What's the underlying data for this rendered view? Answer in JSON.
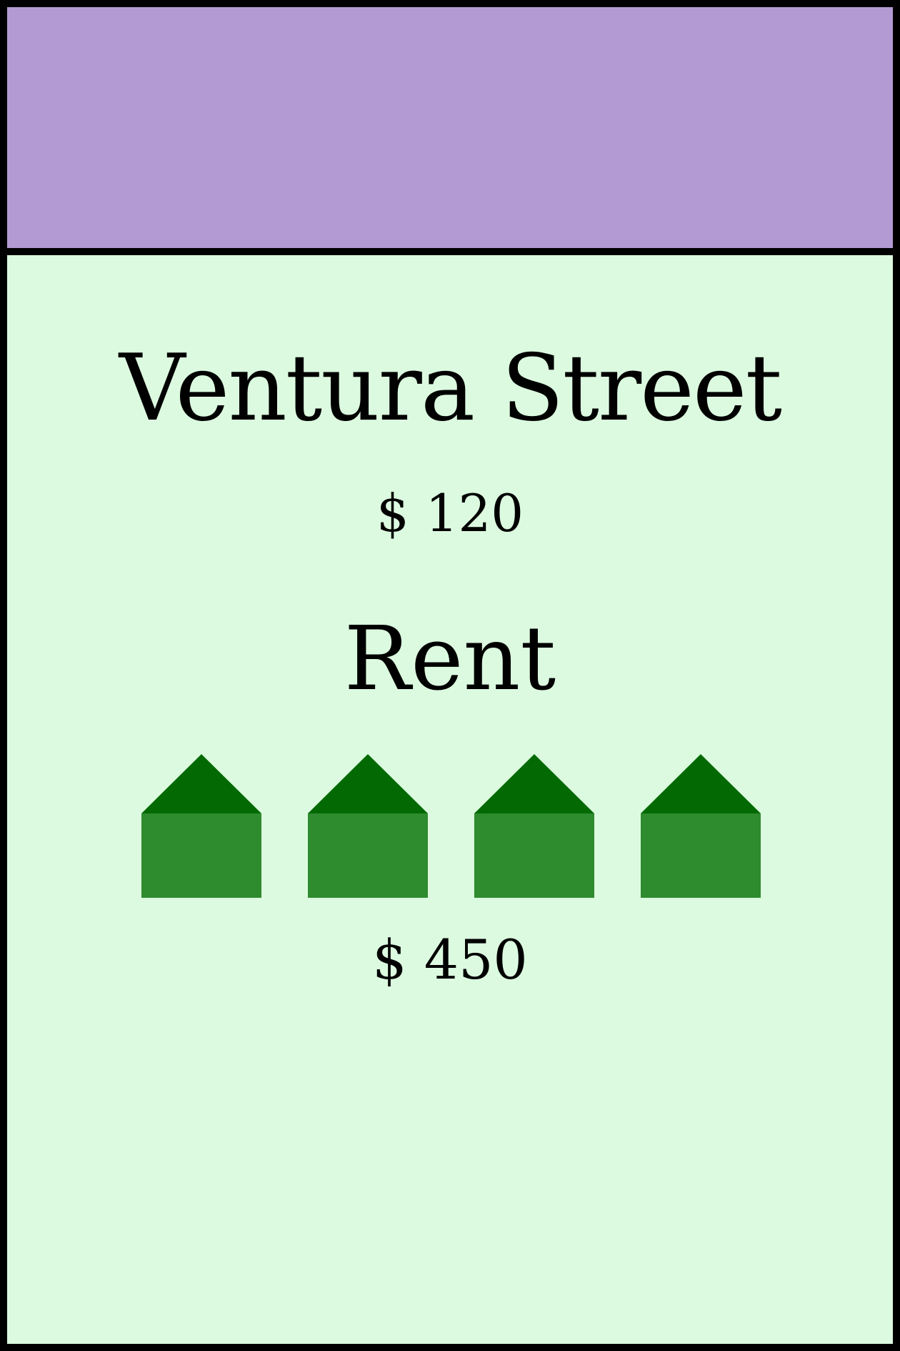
{
  "card": {
    "color_band": "#b49ad2",
    "background": "#dcfadf",
    "name": "Ventura Street",
    "price": "$ 120",
    "rent_heading": "Rent",
    "houses_count": 4,
    "house_icon": "house-icon",
    "house_roof_color": "#036a03",
    "house_body_color": "#2e8b2e",
    "rent_value": "$ 450"
  }
}
